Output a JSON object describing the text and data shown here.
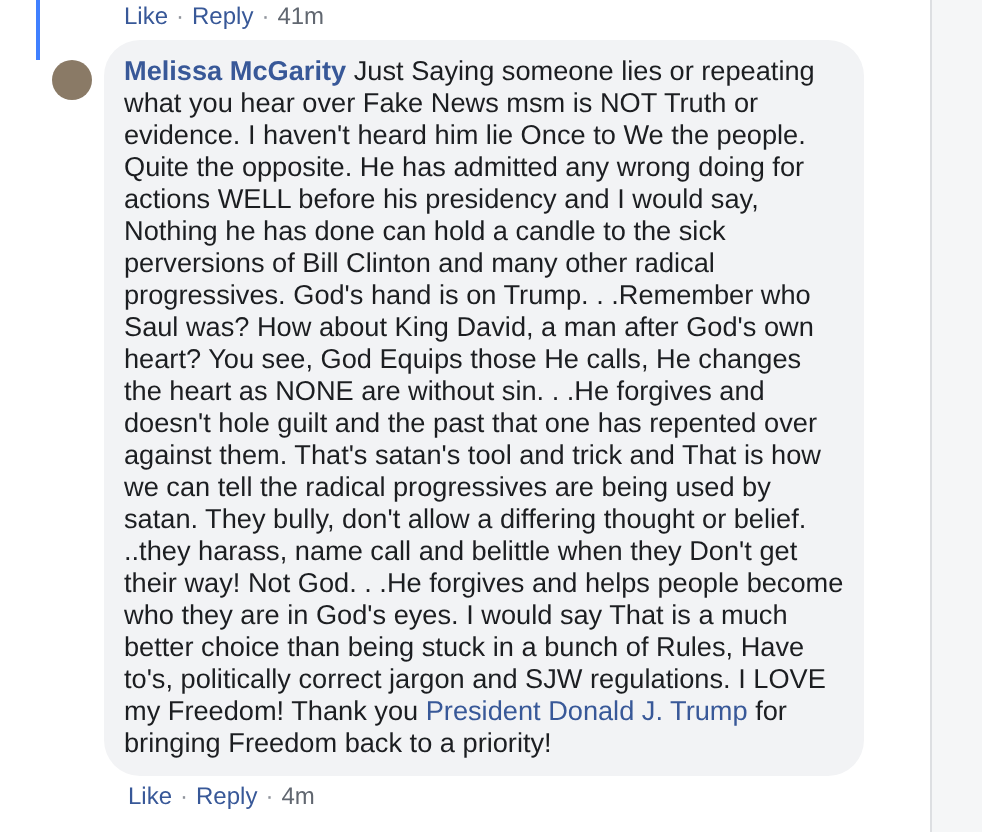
{
  "previous_comment": {
    "meta": [
      {
        "kind": "link",
        "text": "Like"
      },
      {
        "kind": "dot",
        "text": "·"
      },
      {
        "kind": "link",
        "text": "Reply"
      },
      {
        "kind": "dot",
        "text": "·"
      },
      {
        "kind": "time",
        "text": "41m"
      }
    ]
  },
  "comment": {
    "author": "Melissa McGarity",
    "text": "Just Saying someone lies or repeating what you hear over Fake News msm is NOT Truth or evidence. I haven't heard him lie Once to We the people. Quite the opposite. He has admitted any wrong doing for actions WELL before his presidency and I would say, Nothing he has done can hold a candle to the sick perversions of Bill Clinton and many other radical progressives. God's hand is on Trump. . .Remember who Saul was? How about King David, a man after God's own heart? You see, God Equips those He calls, He changes the heart as NONE are without sin. . .He forgives and doesn't hole guilt and the past that one has repented over against them. That's satan's tool and trick and That is how we can tell the radical progressives are being used by satan. They bully, don't allow a differing thought or belief. ..they harass, name call and belittle when they Don't get their way! Not God. . .He forgives and helps people become who they are in God's eyes. I would say That is a much better choice than being stuck in a bunch of Rules, Have to's, politically correct jargon and SJW regulations. I LOVE my Freedom! Thank you",
    "mention": "President Donald J. Trump",
    "text_after": "for bringing Freedom back to a priority!",
    "meta": [
      {
        "kind": "link",
        "text": "Like"
      },
      {
        "kind": "dot",
        "text": "·"
      },
      {
        "kind": "link",
        "text": "Reply"
      },
      {
        "kind": "dot",
        "text": "·"
      },
      {
        "kind": "time",
        "text": "4m"
      }
    ]
  }
}
